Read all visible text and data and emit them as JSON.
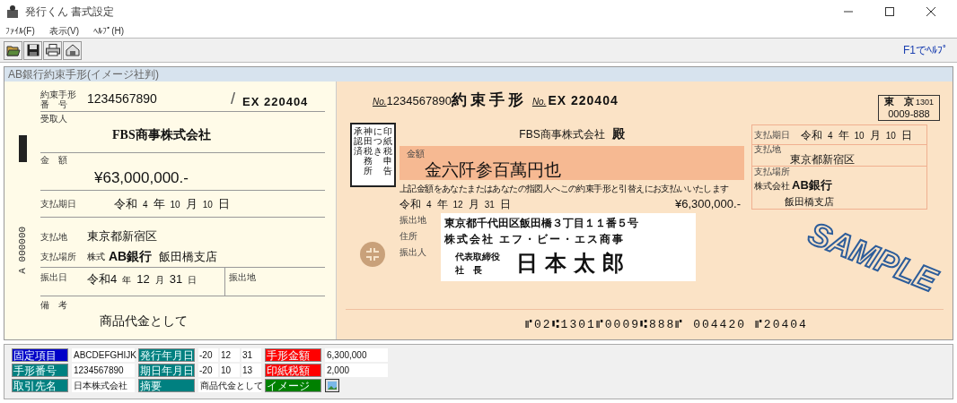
{
  "window": {
    "title": "発行くん 書式設定"
  },
  "menu": [
    "ﾌｧｲﾙ(F)",
    "表示(V)",
    "ﾍﾙﾌﾟ(H)"
  ],
  "toolbar": {
    "buttons": [
      {
        "kind": "open"
      },
      {
        "kind": "save"
      },
      {
        "kind": "print"
      },
      {
        "kind": "settings"
      }
    ],
    "help": "F1でﾍﾙﾌﾟ"
  },
  "panel": {
    "title": "AB銀行約束手形(イメージ社判)",
    "stub": {
      "number_label": [
        "約束手形",
        "番　号"
      ],
      "number": "1234567890",
      "slash": "/",
      "series": "EX 220404",
      "payee_label": "受取人",
      "payee": "FBS商事株式会社",
      "amount_label": "金　額",
      "amount": "¥63,000,000.-",
      "due_label": "支払期日",
      "due_date": [
        "令和",
        "4",
        "年",
        "10",
        "月",
        "10",
        "日"
      ],
      "place_label": "支払地",
      "place": "東京都新宿区",
      "bank_label": "支払場所",
      "bank_prefix": "株式",
      "bank": "AB銀行",
      "branch": "飯田橋支店",
      "issue_label": "振出日",
      "issue_date": [
        "令和4",
        "年",
        "12",
        "月",
        "31",
        "日"
      ],
      "issue_place_label": "振出地",
      "remark_label": "備　考",
      "remark": "商品代金として",
      "serial": "A 000000"
    },
    "note": {
      "no_mark": "No.",
      "number": "1234567890",
      "title": "約束手形",
      "series_mark": "No.",
      "series": "EX 220404",
      "stamp_columns": [
        "承認済",
        "神田税務所",
        "につき",
        "印紙税申告"
      ],
      "payee": "FBS商事株式会社",
      "payee_suffix": "殿",
      "amount_label": "金額",
      "amount_kanji": "金六阡参百萬円也",
      "promise": "上記金額をあなたまたはあなたの指図人へこの約束手形と引替えにお支払いいたします",
      "issue_date": [
        "令和",
        "4",
        "年",
        "12",
        "月",
        "31",
        "日"
      ],
      "amount": "¥6,300,000.-",
      "issuer_labels": [
        "振出地",
        "住所",
        "振出人"
      ],
      "issuer_address": "東京都千代田区飯田橋３丁目１１番５号",
      "issuer_company": "株式会社 エフ・ビー・エス商事",
      "issuer_titles": [
        "代表取締役",
        "社　長"
      ],
      "issuer_name": "日本太郎",
      "clearing": {
        "city": "東　京",
        "code": "1301",
        "number": "0009-888"
      },
      "due_label": "支払期日",
      "due_date": [
        "令和",
        "4",
        "年",
        "10",
        "月",
        "10",
        "日"
      ],
      "place_label": "支払地",
      "place": "東京都新宿区",
      "bank_label": "支払場所",
      "bank_prefix": "株式会社",
      "bank": "AB銀行",
      "branch": "飯田橋支店",
      "stamp": "SAMPLE",
      "micr": "⑈02⑆1301⑈0009⑆888⑈ 004420 ⑈20404"
    }
  },
  "fields": {
    "rows": [
      {
        "items": [
          {
            "kind": "text",
            "label": "固定項目",
            "color": "#0000c8",
            "value": "ABCDEFGHIJK"
          },
          {
            "kind": "date",
            "label": "発行年月日",
            "color": "#008080",
            "parts": [
              "-20",
              "12",
              "31"
            ]
          },
          {
            "kind": "text",
            "label": "手形金額",
            "color": "#ff0000",
            "value": "6,300,000"
          }
        ]
      },
      {
        "items": [
          {
            "kind": "text",
            "label": "手形番号",
            "color": "#008080",
            "value": "1234567890"
          },
          {
            "kind": "date",
            "label": "期日年月日",
            "color": "#008080",
            "parts": [
              "-20",
              "10",
              "13"
            ]
          },
          {
            "kind": "text",
            "label": "印紙税額",
            "color": "#ff0000",
            "value": "2,000"
          }
        ]
      },
      {
        "items": [
          {
            "kind": "text",
            "label": "取引先名",
            "color": "#008080",
            "value": "日本株式会社"
          },
          {
            "kind": "text",
            "label": "摘要",
            "color": "#008080",
            "value": "商品代金として"
          },
          {
            "kind": "image",
            "label": "イメージ",
            "color": "#008000"
          }
        ]
      }
    ]
  }
}
